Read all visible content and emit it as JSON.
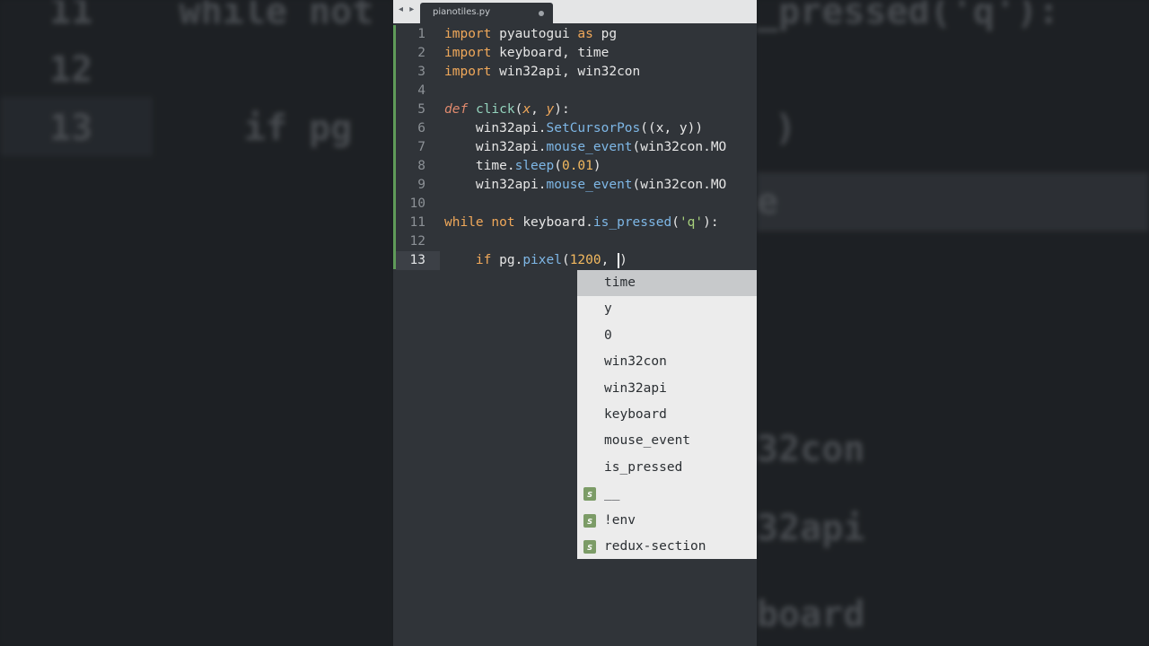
{
  "tab": {
    "nav_icons": "◂ ▸",
    "filename": "pianotiles.py"
  },
  "code_lines": [
    {
      "n": "1",
      "parts": [
        {
          "c": "kw",
          "t": "import"
        },
        {
          "c": "",
          "t": " pyautogui "
        },
        {
          "c": "kw",
          "t": "as"
        },
        {
          "c": "",
          "t": " pg"
        }
      ]
    },
    {
      "n": "2",
      "parts": [
        {
          "c": "kw",
          "t": "import"
        },
        {
          "c": "",
          "t": " keyboard, time"
        }
      ]
    },
    {
      "n": "3",
      "parts": [
        {
          "c": "kw",
          "t": "import"
        },
        {
          "c": "",
          "t": " win32api, win32con"
        }
      ]
    },
    {
      "n": "4",
      "parts": []
    },
    {
      "n": "5",
      "parts": [
        {
          "c": "kwi",
          "t": "def"
        },
        {
          "c": "",
          "t": " "
        },
        {
          "c": "fnd",
          "t": "click"
        },
        {
          "c": "",
          "t": "("
        },
        {
          "c": "prm",
          "t": "x"
        },
        {
          "c": "",
          "t": ", "
        },
        {
          "c": "prm",
          "t": "y"
        },
        {
          "c": "",
          "t": "):"
        }
      ]
    },
    {
      "n": "6",
      "parts": [
        {
          "c": "",
          "t": "    win32api."
        },
        {
          "c": "fn",
          "t": "SetCursorPos"
        },
        {
          "c": "",
          "t": "((x, y))"
        }
      ]
    },
    {
      "n": "7",
      "parts": [
        {
          "c": "",
          "t": "    win32api."
        },
        {
          "c": "fn",
          "t": "mouse_event"
        },
        {
          "c": "",
          "t": "(win32con.MO"
        }
      ]
    },
    {
      "n": "8",
      "parts": [
        {
          "c": "",
          "t": "    time."
        },
        {
          "c": "fn",
          "t": "sleep"
        },
        {
          "c": "",
          "t": "("
        },
        {
          "c": "num",
          "t": "0.01"
        },
        {
          "c": "",
          "t": ")"
        }
      ]
    },
    {
      "n": "9",
      "parts": [
        {
          "c": "",
          "t": "    win32api."
        },
        {
          "c": "fn",
          "t": "mouse_event"
        },
        {
          "c": "",
          "t": "(win32con.MO"
        }
      ]
    },
    {
      "n": "10",
      "parts": []
    },
    {
      "n": "11",
      "parts": [
        {
          "c": "kw",
          "t": "while"
        },
        {
          "c": "",
          "t": " "
        },
        {
          "c": "kw",
          "t": "not"
        },
        {
          "c": "",
          "t": " keyboard."
        },
        {
          "c": "fn",
          "t": "is_pressed"
        },
        {
          "c": "",
          "t": "("
        },
        {
          "c": "str",
          "t": "'q'"
        },
        {
          "c": "",
          "t": "):"
        }
      ]
    },
    {
      "n": "12",
      "parts": []
    },
    {
      "n": "13",
      "current": true,
      "parts": [
        {
          "c": "",
          "t": "    "
        },
        {
          "c": "kw",
          "t": "if"
        },
        {
          "c": "",
          "t": " pg."
        },
        {
          "c": "fn",
          "t": "pixel"
        },
        {
          "c": "",
          "t": "("
        },
        {
          "c": "num",
          "t": "1200"
        },
        {
          "c": "",
          "t": ", "
        },
        {
          "c": "cursor",
          "t": ""
        },
        {
          "c": "",
          "t": ")"
        }
      ]
    }
  ],
  "autocomplete": [
    {
      "label": "time",
      "kind": "",
      "selected": true
    },
    {
      "label": "y",
      "kind": ""
    },
    {
      "label": "0",
      "kind": ""
    },
    {
      "label": "win32con",
      "kind": ""
    },
    {
      "label": "win32api",
      "kind": ""
    },
    {
      "label": "keyboard",
      "kind": ""
    },
    {
      "label": "mouse_event",
      "kind": ""
    },
    {
      "label": "is_pressed",
      "kind": ""
    },
    {
      "label": "__",
      "kind": "s"
    },
    {
      "label": "!env",
      "kind": "s"
    },
    {
      "label": "redux-section",
      "kind": "s"
    }
  ],
  "background_left": [
    {
      "t": "11    while not",
      "cls": "l1"
    },
    {
      "t": "12",
      "cls": "l2"
    },
    {
      "t": "13       if pg",
      "cls": "l3"
    }
  ],
  "background_right": [
    {
      "t": "_pressed('q'):",
      "cls": "r1"
    },
    {
      "t": ")",
      "cls": "r2"
    },
    {
      "t": "e",
      "cls": "r3"
    },
    {
      "t": "32con",
      "cls": "r4"
    },
    {
      "t": "32api",
      "cls": "r5"
    },
    {
      "t": "board",
      "cls": "r6"
    }
  ]
}
